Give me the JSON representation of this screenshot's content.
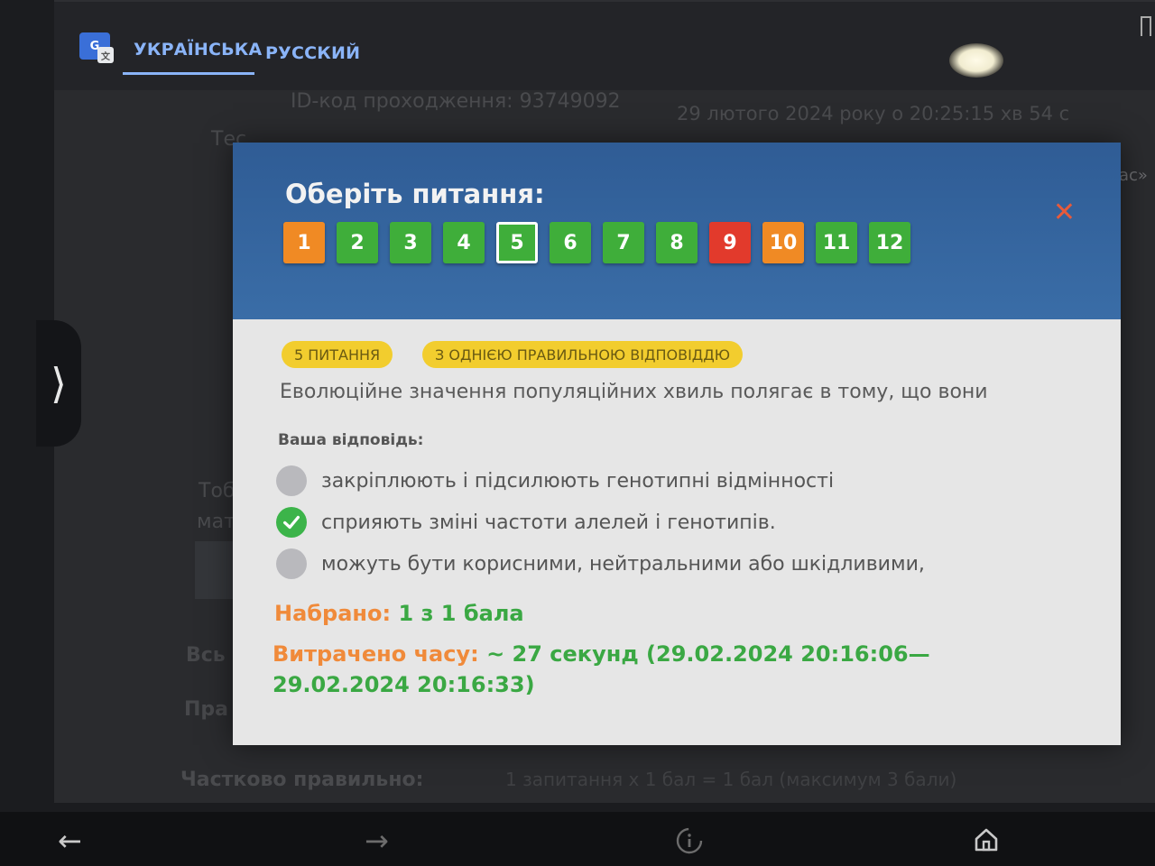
{
  "translate_bar": {
    "logo_text": "G",
    "tabs": [
      {
        "label": "УКРАЇНСЬКА",
        "active": true
      },
      {
        "label": "РУССКИЙ",
        "active": false
      }
    ]
  },
  "background_page": {
    "passage_id": "ID-код проходження: 93749092",
    "date_text": "29 лютого 2024 року о 20:25:15 хв 54 с",
    "test_fragment": "Тес",
    "fragment_right": "ас»",
    "left_fragment_1": "Тоб",
    "left_fragment_2": "мат",
    "left_fragment_3": "Всь",
    "left_fragment_4": "Пра",
    "partially_correct_label": "Частково правильно:",
    "partially_correct_value": "1 запитання х 1 бал = 1 бал (максимум 3 бали)"
  },
  "modal": {
    "title": "Оберіть питання:",
    "close_symbol": "✕",
    "questions": [
      {
        "num": "1",
        "status": "orange"
      },
      {
        "num": "2",
        "status": "green"
      },
      {
        "num": "3",
        "status": "green"
      },
      {
        "num": "4",
        "status": "green"
      },
      {
        "num": "5",
        "status": "current"
      },
      {
        "num": "6",
        "status": "green"
      },
      {
        "num": "7",
        "status": "green"
      },
      {
        "num": "8",
        "status": "green"
      },
      {
        "num": "9",
        "status": "red"
      },
      {
        "num": "10",
        "status": "orange"
      },
      {
        "num": "11",
        "status": "green"
      },
      {
        "num": "12",
        "status": "green"
      }
    ],
    "pill_question_no": "5 ПИТАННЯ",
    "pill_type": "З ОДНІЄЮ ПРАВИЛЬНОЮ ВІДПОВІДДЮ",
    "question_text": "Еволюційне значення популяційних хвиль полягає в тому, що вони",
    "answer_label": "Ваша відповідь:",
    "options": [
      {
        "text": "закріплюють і підсилюють генотипні відмінності",
        "selected": false
      },
      {
        "text": "сприяють зміні частоти алелей і генотипів.",
        "selected": true
      },
      {
        "text": "можуть бути корисними, нейтральними або шкідливими,",
        "selected": false
      }
    ],
    "score_label": "Набрано:",
    "score_value": "1 з 1 бала",
    "time_label": "Витрачено часу:",
    "time_value": "~ 27 секунд (29.02.2024 20:16:06—29.02.2024 20:16:33)"
  },
  "colors": {
    "green": "#3fae3a",
    "orange": "#f08a24",
    "red": "#e23a2c",
    "header_blue": "#3a6da7",
    "pill_yellow": "#f2cd2e"
  },
  "icons": {
    "side": "chevron-right-icon",
    "nav": [
      "back-arrow-icon",
      "forward-arrow-icon",
      "info-sparkle-icon",
      "home-icon"
    ]
  }
}
